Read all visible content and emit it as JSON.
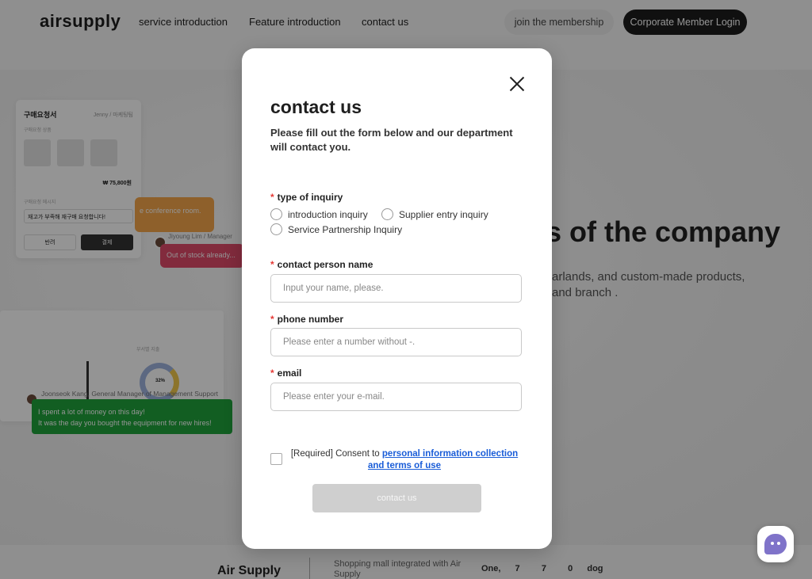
{
  "header": {
    "logo": "airsupply",
    "nav": [
      "service introduction",
      "Feature introduction",
      "contact us"
    ],
    "join_label": "join the membership",
    "login_label": "Corporate Member Login"
  },
  "hero": {
    "title_visible": "s of the company",
    "subtitle_line1": "arlands, and custom-made products,",
    "subtitle_line2": "and branch ."
  },
  "bg_cards": {
    "po_title": "구매요청서",
    "po_user": "Jenny / 마케팅팀",
    "po_section": "구매요청 상품",
    "po_price": "₩ 75,800원",
    "po_msg_label": "구매요청 메시지",
    "po_msg": "재고가 부족해 재구매 요청합니다!",
    "po_reject": "반려",
    "po_approve": "결제",
    "bubble_orange": "e conference room.",
    "pink_name": "Jiyoung Lim / Manager",
    "bubble_pink": "Out of stock already...",
    "chart_title": "부서별 지출",
    "chart_pct": "32%",
    "green_name": "Joonseok Kang, General Manager of Management Support",
    "bubble_green_1": "I spent a lot of money on this day!",
    "bubble_green_2": "It was the day you bought the equipment for new hires!"
  },
  "footer": {
    "brand": "Air Supply",
    "desc": "Shopping mall integrated with Air Supply",
    "stat": "One,  7   7   0  dog"
  },
  "modal": {
    "title": "contact us",
    "description": "Please fill out the form below and our department will contact you.",
    "required_mark": "*",
    "inquiry_label": "type of inquiry",
    "inquiry_options": [
      "introduction inquiry",
      "Supplier entry inquiry",
      "Service Partnership Inquiry"
    ],
    "name_label": "contact person name",
    "name_placeholder": "Input your name, please.",
    "phone_label": "phone number",
    "phone_placeholder": "Please enter a number without -.",
    "email_label": "email",
    "email_placeholder": "Please enter your e-mail.",
    "consent_prefix": "[Required] Consent to ",
    "consent_link": "personal information collection and terms of use",
    "submit_label": "contact us"
  },
  "colors": {
    "required": "#e53935",
    "link": "#1a5dd8",
    "submit_disabled": "#cfcfcf",
    "login_bg": "#1c1c1c"
  }
}
